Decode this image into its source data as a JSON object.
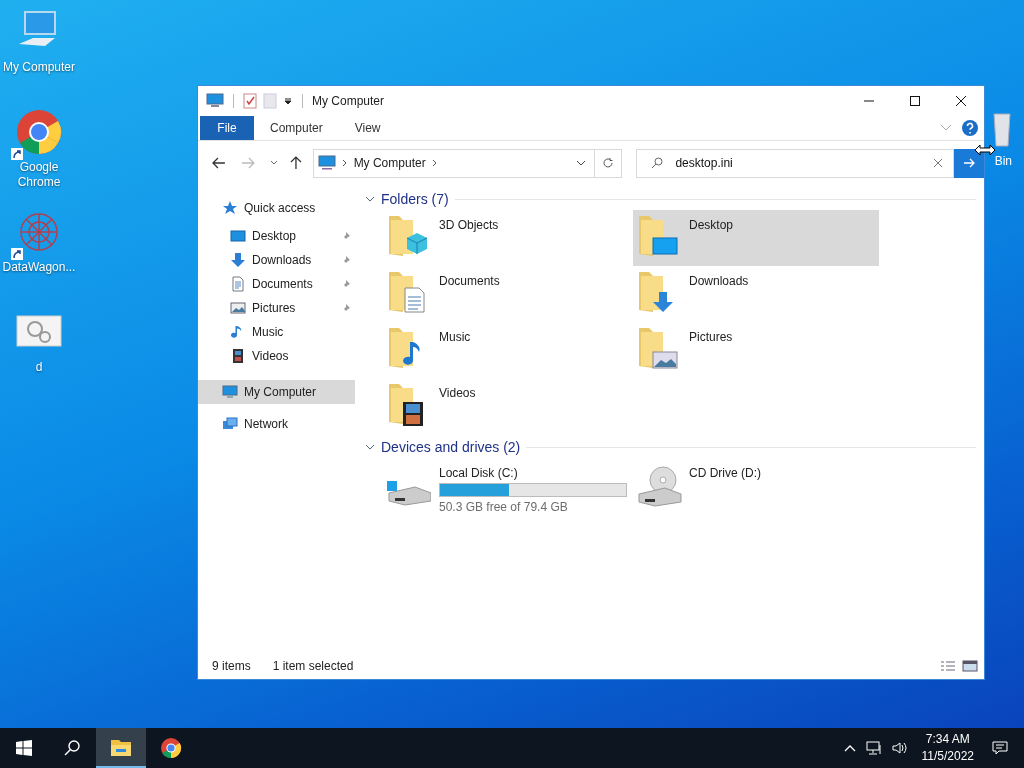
{
  "desktop_icons": [
    {
      "label": "My Computer",
      "kind": "computer",
      "shortcut": false
    },
    {
      "label": "Google Chrome",
      "kind": "chrome",
      "shortcut": true
    },
    {
      "label": "DataWagon...",
      "kind": "pattern",
      "shortcut": true
    },
    {
      "label": "d",
      "kind": "gears",
      "shortcut": false
    }
  ],
  "recycle_bin": {
    "label": "Bin"
  },
  "window": {
    "title": "My Computer",
    "ribbon_tabs": [
      {
        "label": "File",
        "selected": true
      },
      {
        "label": "Computer",
        "selected": false
      },
      {
        "label": "View",
        "selected": false
      }
    ],
    "address": {
      "crumbs": [
        "My Computer"
      ]
    },
    "search": {
      "value": "desktop.ini"
    },
    "nav": [
      {
        "label": "Quick access",
        "kind": "star",
        "selected": false,
        "children": [
          {
            "label": "Desktop",
            "kind": "desktop",
            "pinned": true,
            "selected": false
          },
          {
            "label": "Downloads",
            "kind": "downloads",
            "pinned": true,
            "selected": false
          },
          {
            "label": "Documents",
            "kind": "documents",
            "pinned": true,
            "selected": false
          },
          {
            "label": "Pictures",
            "kind": "pictures",
            "pinned": true,
            "selected": false
          },
          {
            "label": "Music",
            "kind": "music",
            "pinned": false,
            "selected": false
          },
          {
            "label": "Videos",
            "kind": "videos",
            "pinned": false,
            "selected": false
          }
        ]
      },
      {
        "label": "My Computer",
        "kind": "computer",
        "selected": true
      },
      {
        "label": "Network",
        "kind": "network",
        "selected": false
      }
    ],
    "sections": [
      {
        "title": "Folders (7)",
        "expanded": true,
        "items": [
          {
            "label": "3D Objects",
            "kind": "objects3d",
            "selected": false
          },
          {
            "label": "Desktop",
            "kind": "desktop",
            "selected": true
          },
          {
            "label": "Documents",
            "kind": "documents",
            "selected": false
          },
          {
            "label": "Downloads",
            "kind": "downloads",
            "selected": false
          },
          {
            "label": "Music",
            "kind": "music",
            "selected": false
          },
          {
            "label": "Pictures",
            "kind": "pictures",
            "selected": false
          },
          {
            "label": "Videos",
            "kind": "videos",
            "selected": false
          }
        ]
      },
      {
        "title": "Devices and drives (2)",
        "expanded": true,
        "items": [
          {
            "label": "Local Disk (C:)",
            "kind": "disk",
            "level": 0.37,
            "free": "50.3 GB free of 79.4 GB",
            "selected": false
          },
          {
            "label": "CD Drive (D:)",
            "kind": "cd",
            "selected": false
          }
        ]
      }
    ],
    "status_bar": {
      "count": "9 items",
      "selection": "1 item selected"
    }
  },
  "taskbar": {
    "apps": [
      {
        "kind": "explorer",
        "active": true
      },
      {
        "kind": "chrome",
        "active": false
      }
    ],
    "time": "7:34 AM",
    "date": "11/5/2022"
  }
}
